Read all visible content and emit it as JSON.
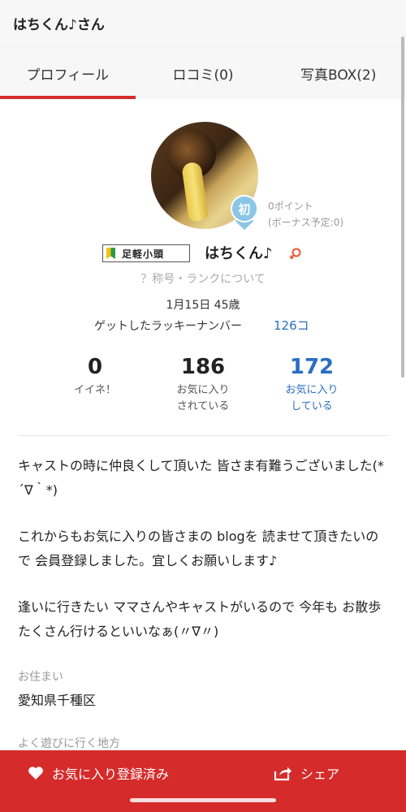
{
  "header": {
    "title": "はちくん♪さん"
  },
  "tabs": [
    {
      "label": "プロフィール",
      "active": true
    },
    {
      "label": "ロコミ(0)",
      "active": false
    },
    {
      "label": "写真BOX(2)",
      "active": false
    }
  ],
  "profile": {
    "avatar_badge": "初",
    "points": "0ポイント",
    "bonus": "(ボーナス予定:0)",
    "rank_title": "足軽小頭",
    "name": "はちくん♪",
    "rank_about": "？称号・ランクについて",
    "birth": "1月15日 45歳",
    "lucky_label": "ゲットしたラッキーナンバー",
    "lucky_count": "126コ"
  },
  "stats": [
    {
      "value": "0",
      "label_line1": "イイネ！",
      "label_line2": ""
    },
    {
      "value": "186",
      "label_line1": "お気に入り",
      "label_line2": "されている"
    },
    {
      "value": "172",
      "label_line1": "お気に入り",
      "label_line2": "している"
    }
  ],
  "bio": {
    "p1": "キャストの時に仲良くして頂いた 皆さま有難うございました(*´∇｀*)",
    "p2": "これからもお気に入りの皆さまの blogを 読ませて頂きたいので 会員登録しました。宜しくお願いします♪",
    "p3": "逢いに行きたい ママさんやキャストがいるので 今年も お散歩 たくさん行けるといいなぁ(〃∇〃)"
  },
  "residence": {
    "label": "お住まい",
    "value": "愛知県千種区"
  },
  "play_area": {
    "label": "よく遊びに行く地方"
  },
  "bottom_bar": {
    "favorite_label": "お気に入り登録済み",
    "share_label": "シェア"
  },
  "colors": {
    "accent": "#d62b2b",
    "link": "#2a6fc0",
    "badge": "#8cc6e6"
  }
}
